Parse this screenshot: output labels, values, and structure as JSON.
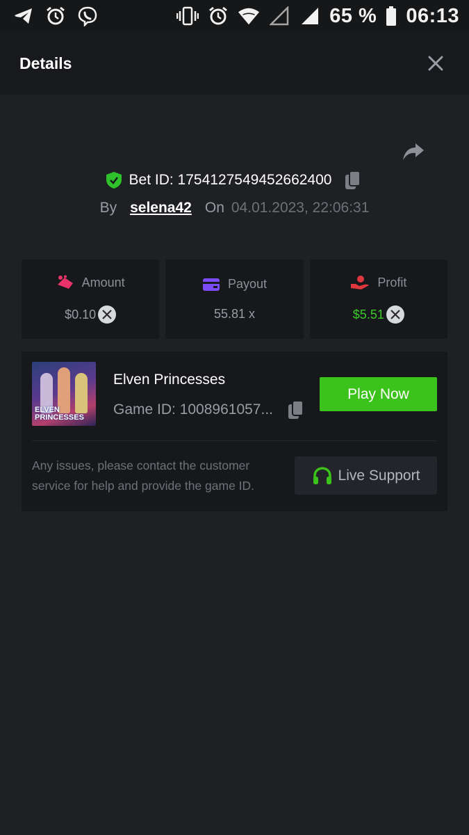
{
  "status_bar": {
    "battery": "65 %",
    "time": "06:13",
    "icons": [
      "telegram-icon",
      "alarm-icon",
      "viber-icon",
      "vibrate-icon",
      "alarm-icon",
      "wifi-icon",
      "signal-empty-icon",
      "signal-icon",
      "battery-icon"
    ]
  },
  "header": {
    "title": "Details",
    "close_icon": "close-icon"
  },
  "bet": {
    "id_label": "Bet ID: 1754127549452662400",
    "by_label": "By",
    "user": "selena42",
    "on_label": "On",
    "date": "04.01.2023, 22:06:31"
  },
  "stats": {
    "amount": {
      "label": "Amount",
      "value": "$0.10",
      "icon": "amount-icon",
      "color": "#e8336a"
    },
    "payout": {
      "label": "Payout",
      "value": "55.81 x",
      "icon": "payout-card-icon",
      "color": "#7b4cf5"
    },
    "profit": {
      "label": "Profit",
      "value": "$5.51",
      "icon": "profit-hand-icon",
      "color": "#e0363d"
    }
  },
  "game": {
    "name": "Elven Princesses",
    "id_label": "Game ID: 1008961057...",
    "thumb_text_1": "ELVEN",
    "thumb_text_2": "PRINCESSES",
    "play_label": "Play Now",
    "issue_text": "Any issues, please contact the customer service for help and provide the game ID.",
    "support_label": "Live Support"
  },
  "colors": {
    "accent_green": "#3cc31b",
    "background": "#1f2024",
    "card": "#17181b"
  }
}
